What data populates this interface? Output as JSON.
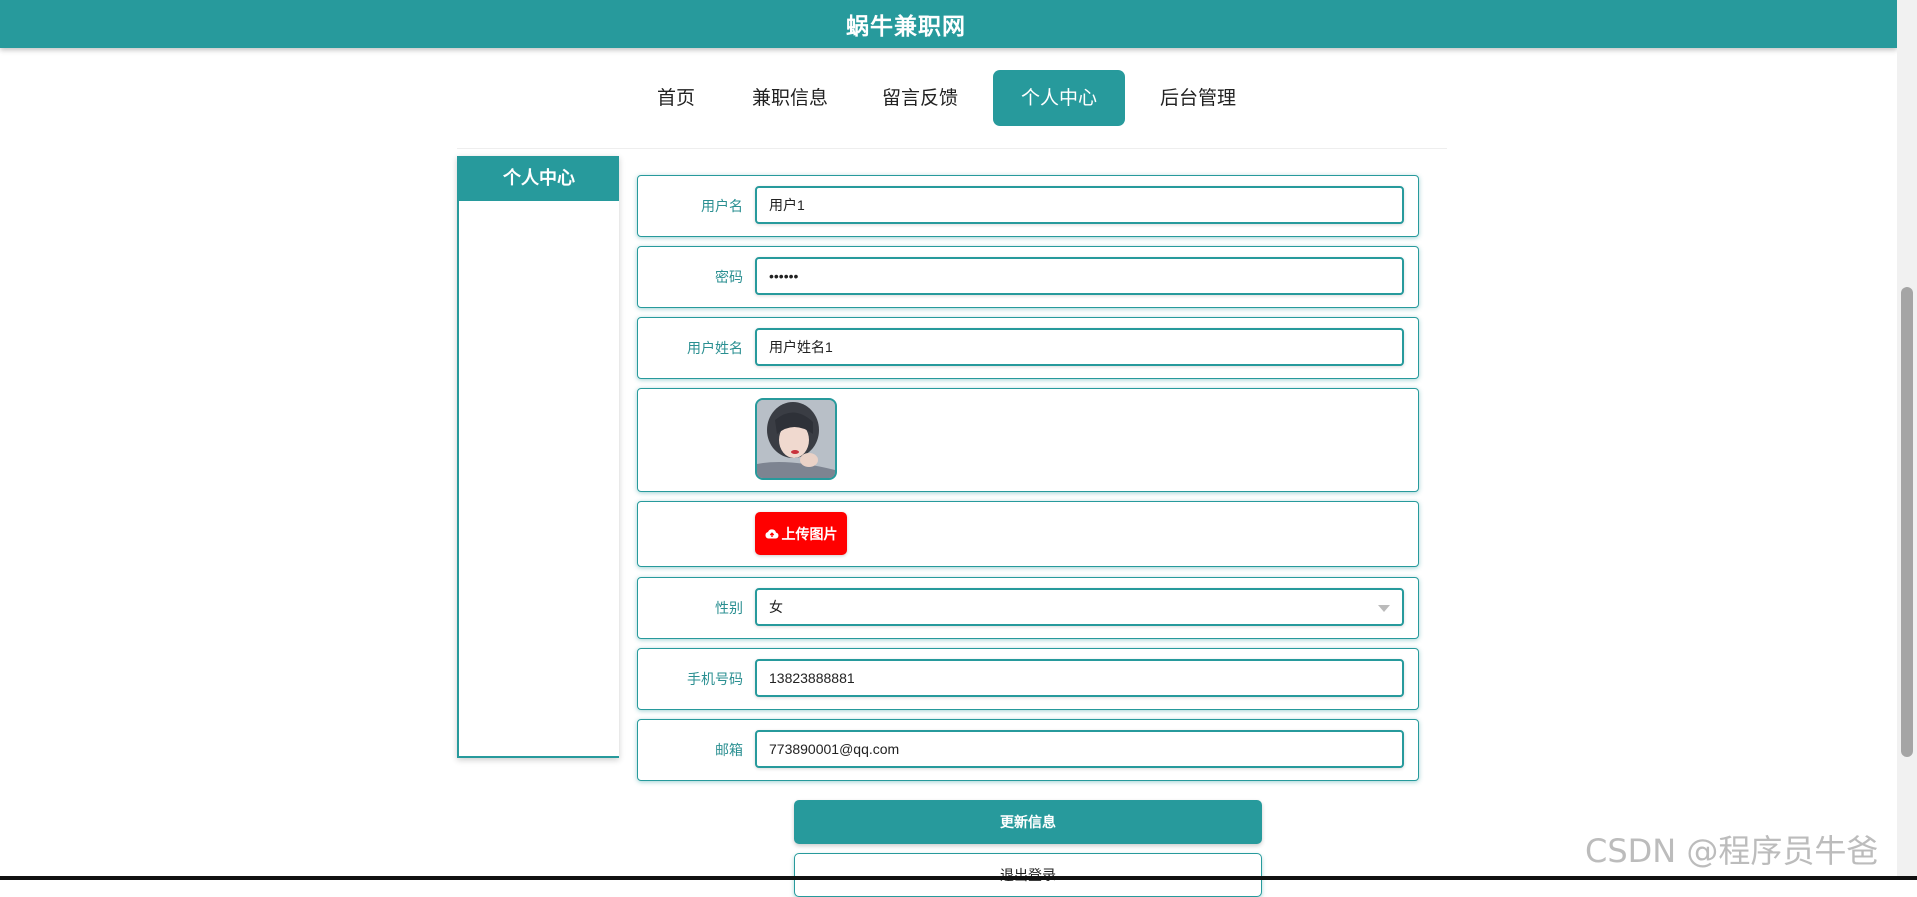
{
  "header": {
    "title": "蜗牛兼职网"
  },
  "nav": {
    "items": [
      {
        "label": "首页"
      },
      {
        "label": "兼职信息"
      },
      {
        "label": "留言反馈"
      },
      {
        "label": "个人中心"
      },
      {
        "label": "后台管理"
      }
    ],
    "active": "个人中心"
  },
  "sidebar": {
    "title": "个人中心"
  },
  "form": {
    "username": {
      "label": "用户名",
      "value": "用户1"
    },
    "password": {
      "label": "密码",
      "value": "123456"
    },
    "realname": {
      "label": "用户姓名",
      "value": "用户姓名1"
    },
    "upload": {
      "label": "上传图片",
      "icon": "cloud-upload-icon"
    },
    "gender": {
      "label": "性别",
      "value": "女"
    },
    "phone": {
      "label": "手机号码",
      "value": "13823888881"
    },
    "email": {
      "label": "邮箱",
      "value": "773890001@qq.com"
    }
  },
  "actions": {
    "update_label": "更新信息",
    "logout_label": "退出登录"
  },
  "watermark": "CSDN @程序员牛爸",
  "colors": {
    "primary": "#279a9c",
    "upload": "#ff0000"
  }
}
